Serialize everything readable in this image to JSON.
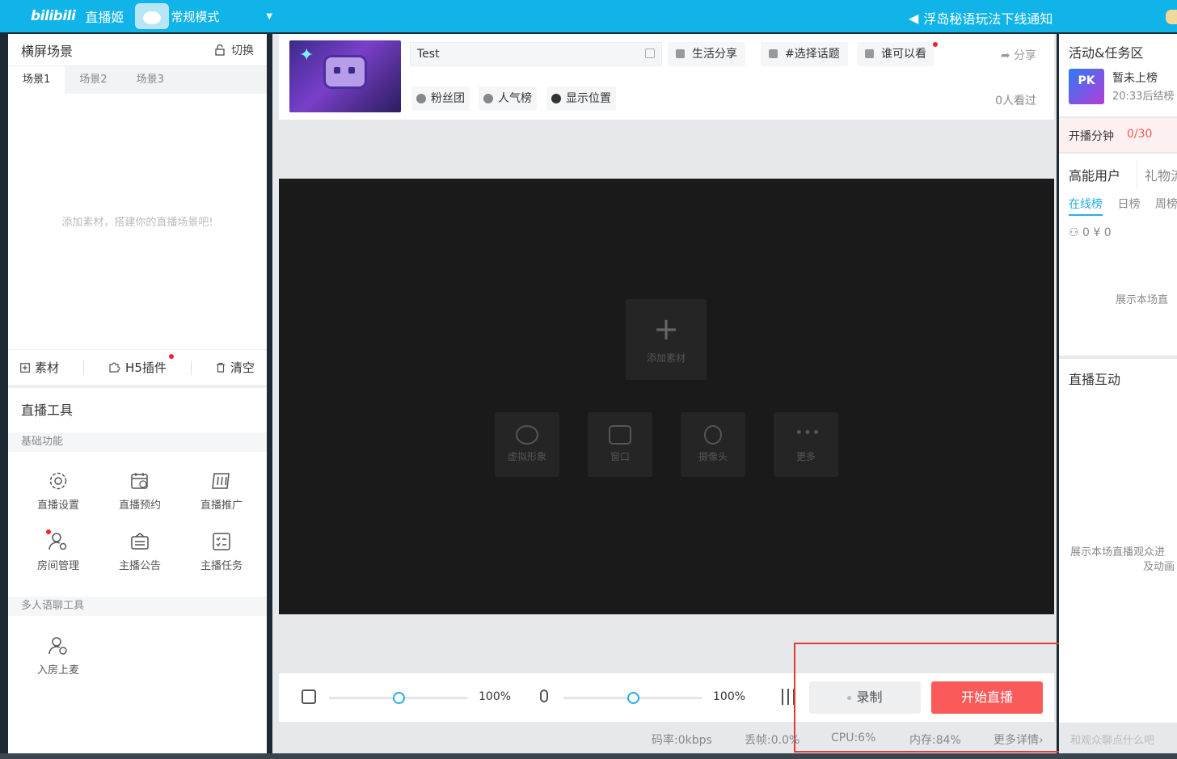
{
  "topbar": {
    "logo": "bilibili",
    "app_name": "直播姬",
    "mode": "常规模式",
    "notice": "浮岛秘语玩法下线通知"
  },
  "left": {
    "scene_title": "横屏场景",
    "switch_label": "切换",
    "tabs": [
      "场景1",
      "场景2",
      "场景3"
    ],
    "empty_hint": "添加素材，搭建你的直播场景吧!",
    "actions": [
      "素材",
      "H5插件",
      "清空"
    ],
    "tools_title": "直播工具",
    "section_basic": "基础功能",
    "basic_tools": [
      "直播设置",
      "直播预约",
      "直播推广",
      "房间管理",
      "主播公告",
      "主播任务"
    ],
    "section_multi": "多人语聊工具",
    "multi_tools": [
      "入房上麦"
    ]
  },
  "info": {
    "title_value": "Test",
    "chips": [
      "生活分享",
      "#选择话题",
      "谁可以看"
    ],
    "share": "分享",
    "tags": [
      "粉丝团",
      "人气榜",
      "显示位置"
    ],
    "viewers": "0人看过"
  },
  "preview": {
    "add_label": "添加素材",
    "sources": [
      "虚拟形象",
      "窗口",
      "摄像头",
      "更多"
    ]
  },
  "controls": {
    "speaker_pct": "100%",
    "mic_pct": "100%",
    "speaker_level": 0.5,
    "mic_level": 0.5,
    "record_label": "录制",
    "live_label": "开始直播"
  },
  "status": {
    "bitrate": "码率:0kbps",
    "drop": "丢帧:0.0%",
    "cpu": "CPU:6%",
    "mem": "内存:84%",
    "more": "更多详情›"
  },
  "right": {
    "activity_title": "活动&任务区",
    "rank_status": "暂未上榜",
    "rank_time": "20:33后结榜",
    "broadcast_minutes_label": "开播分钟",
    "broadcast_minutes_value": "0/30",
    "users_tab": "高能用户",
    "gifts_tab": "礼物流",
    "sub_tabs": [
      "在线榜",
      "日榜",
      "周榜"
    ],
    "counts": "0  ¥ 0",
    "users_hint": "展示本场直",
    "interact_title": "直播互动",
    "interact_hint_1": "展示本场直播观众进",
    "interact_hint_2": "及动画",
    "chat_placeholder": "和观众聊点什么吧"
  },
  "colors": {
    "topbar": "#10b4e8",
    "accent": "#23ade5",
    "live_button": "#fb5a5a",
    "highlight": "#e53935"
  }
}
